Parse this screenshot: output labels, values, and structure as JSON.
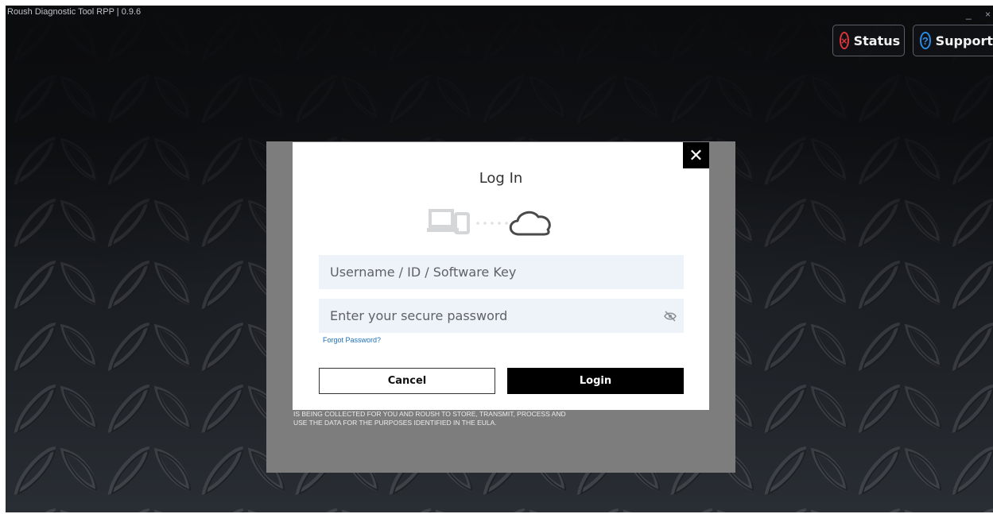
{
  "app": {
    "title": "Roush Diagnostic Tool RPP | 0.9.6",
    "minimize_glyph": "_",
    "close_glyph": "×"
  },
  "toolbar": {
    "status_label": "Status",
    "status_icon": "error-circle-icon",
    "status_color": "#e0353b",
    "support_label": "Support",
    "support_icon": "help-circle-icon",
    "support_color": "#2a8ce6"
  },
  "background_panel": {
    "eula_text": "IS BEING COLLECTED FOR YOU AND ROUSH TO STORE, TRANSMIT, PROCESS AND USE THE DATA FOR THE PURPOSES IDENTIFIED IN THE EULA."
  },
  "login_modal": {
    "close_glyph": "✕",
    "title": "Log In",
    "icon": "device-to-cloud-icon",
    "username_placeholder": "Username / ID / Software Key",
    "username_value": "",
    "password_placeholder": "Enter your secure password",
    "password_value": "",
    "password_toggle_icon": "eye-slash-icon",
    "forgot_password": "Forgot Password?",
    "cancel_label": "Cancel",
    "login_label": "Login"
  }
}
